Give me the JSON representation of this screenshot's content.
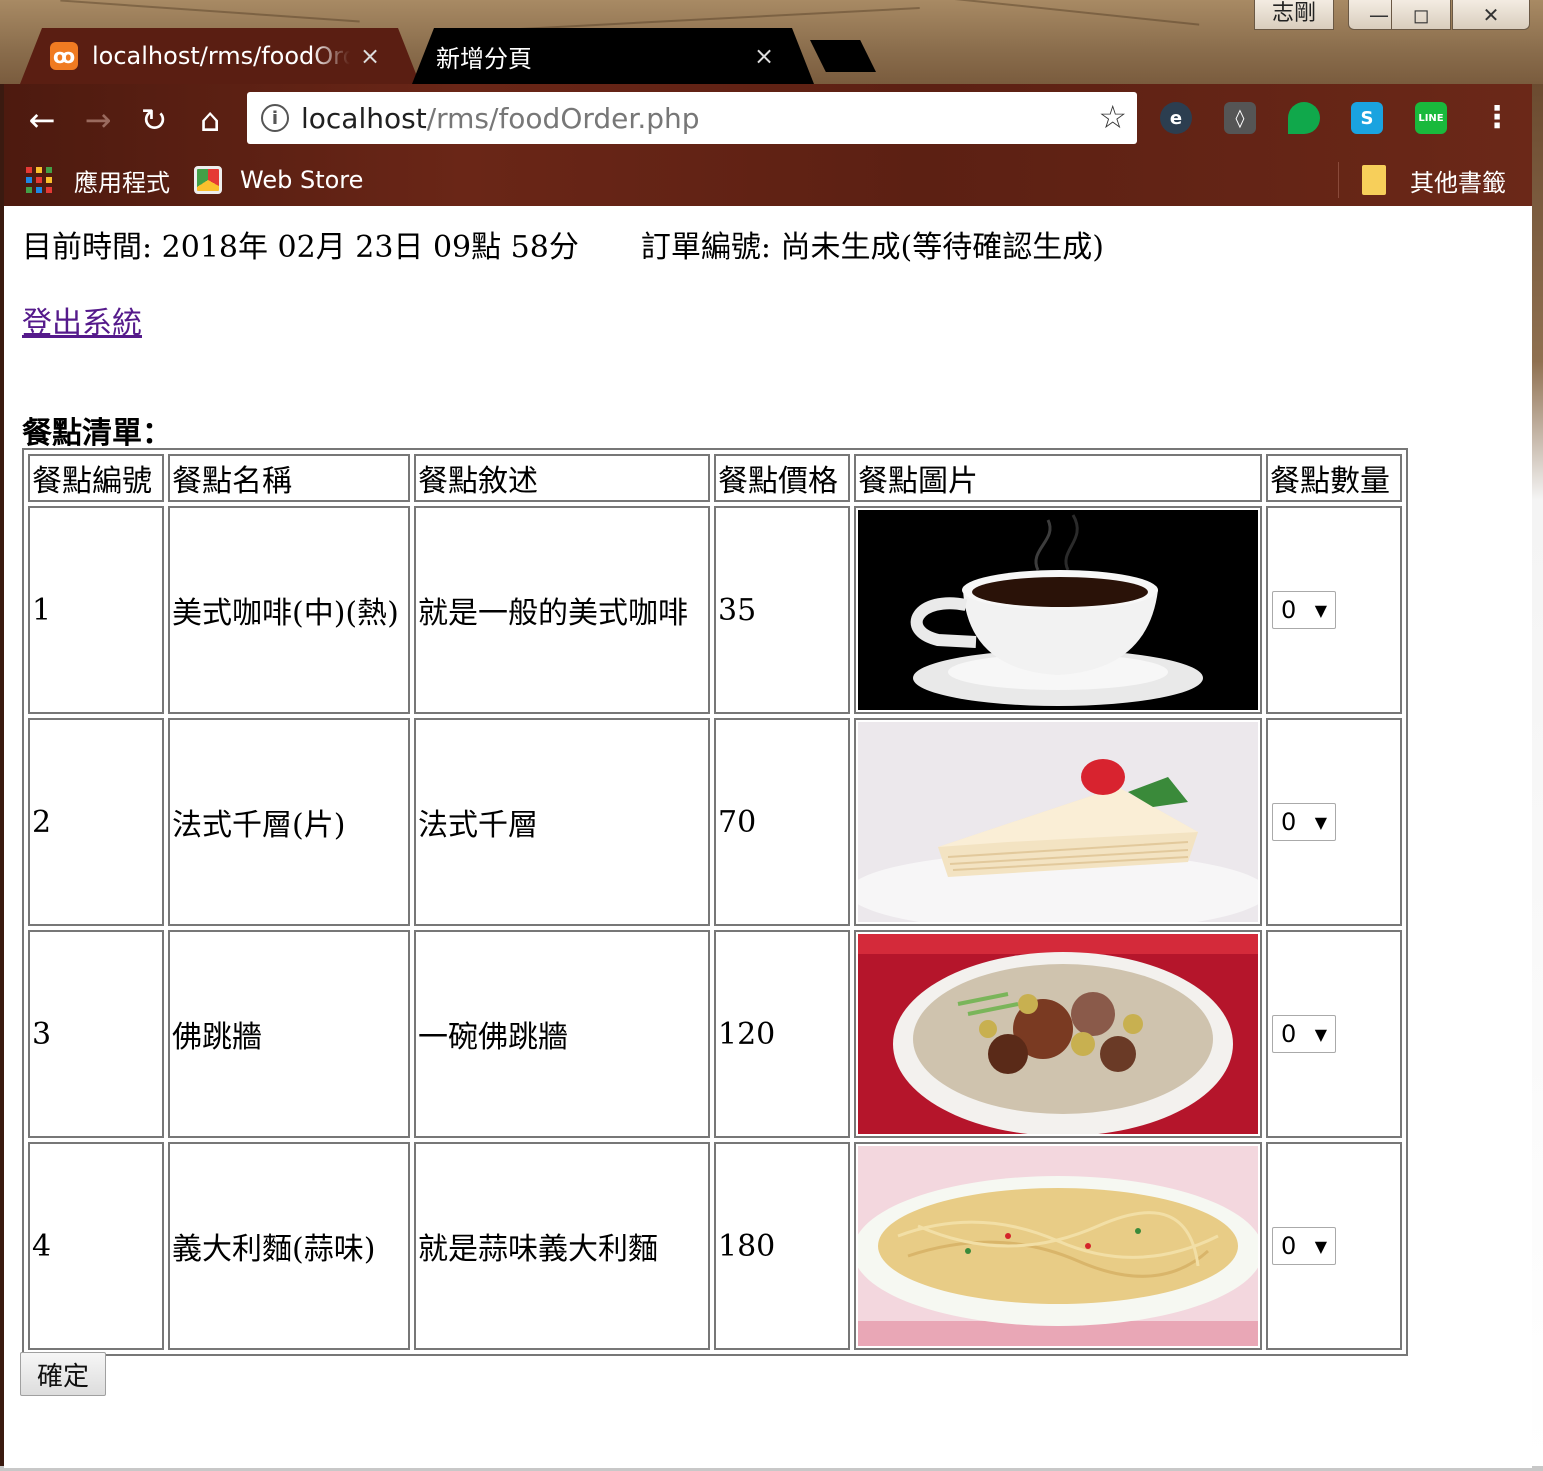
{
  "window": {
    "user_badge": "志剛",
    "minimize_glyph": "—",
    "maximize_glyph": "◻",
    "close_glyph": "✕"
  },
  "tabs": [
    {
      "title": "localhost/rms/foodOrder.php",
      "close": "×",
      "favicon": "xampp-icon",
      "active": true
    },
    {
      "title": "新增分頁",
      "close": "×",
      "active": false
    }
  ],
  "toolbar": {
    "url_host": "localhost",
    "url_path": "/rms/foodOrder.php",
    "extensions": [
      "evernote-icon",
      "keep-icon",
      "hangouts-icon",
      "skype-icon",
      "line-icon"
    ]
  },
  "bookmarks": {
    "apps": "應用程式",
    "webstore": "Web Store",
    "other": "其他書籤"
  },
  "page": {
    "time_line": "目前時間: 2018年 02月 23日 09點 58分",
    "order_line": "訂單編號: 尚未生成(等待確認生成)",
    "logout": "登出系統",
    "heading": "餐點清單：",
    "columns": [
      "餐點編號",
      "餐點名稱",
      "餐點敘述",
      "餐點價格",
      "餐點圖片",
      "餐點數量"
    ],
    "rows": [
      {
        "id": "1",
        "name": "美式咖啡(中)(熱)",
        "desc": "就是一般的美式咖啡",
        "price": "35",
        "image": "coffee-image",
        "qty": "0"
      },
      {
        "id": "2",
        "name": "法式千層(片)",
        "desc": "法式千層",
        "price": "70",
        "image": "crepe-cake-image",
        "qty": "0"
      },
      {
        "id": "3",
        "name": "佛跳牆",
        "desc": "一碗佛跳牆",
        "price": "120",
        "image": "soup-image",
        "qty": "0"
      },
      {
        "id": "4",
        "name": "義大利麵(蒜味)",
        "desc": "就是蒜味義大利麵",
        "price": "180",
        "image": "pasta-image",
        "qty": "0"
      }
    ],
    "confirm": "確定"
  }
}
